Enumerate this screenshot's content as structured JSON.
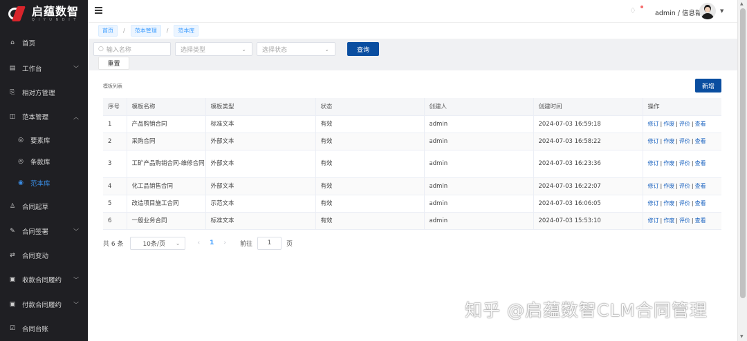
{
  "brand": {
    "title": "启蕴数智",
    "subtitle": "Q I Y U N   D I T"
  },
  "sidebar": {
    "items": [
      {
        "label": "首页",
        "icon": "home-icon",
        "glyph": "⌂",
        "expandable": false
      },
      {
        "label": "工作台",
        "icon": "workbench-icon",
        "glyph": "▤",
        "expandable": true
      },
      {
        "label": "相对方管理",
        "icon": "counterparty-icon",
        "glyph": "⎘",
        "expandable": false
      },
      {
        "label": "范本管理",
        "icon": "template-icon",
        "glyph": "◫",
        "expandable": true,
        "expanded": true
      },
      {
        "label": "要素库",
        "icon": "element-icon",
        "glyph": "◎",
        "sub": true
      },
      {
        "label": "条款库",
        "icon": "clause-icon",
        "glyph": "◎",
        "sub": true
      },
      {
        "label": "范本库",
        "icon": "template-lib-icon",
        "glyph": "◉",
        "sub": true,
        "active": true
      },
      {
        "label": "合同起草",
        "icon": "draft-icon",
        "glyph": "♙",
        "expandable": false
      },
      {
        "label": "合同签署",
        "icon": "sign-icon",
        "glyph": "✎",
        "expandable": true
      },
      {
        "label": "合同变动",
        "icon": "change-icon",
        "glyph": "⇄",
        "expandable": false
      },
      {
        "label": "收款合同履约",
        "icon": "receipt-icon",
        "glyph": "▣",
        "expandable": true
      },
      {
        "label": "付款合同履约",
        "icon": "payment-icon",
        "glyph": "▣",
        "expandable": true
      },
      {
        "label": "合同台账",
        "icon": "ledger-icon",
        "glyph": "☑",
        "expandable": false
      }
    ]
  },
  "header": {
    "user": "admin / 信息部"
  },
  "breadcrumb": [
    "首页",
    "范本管理",
    "范本库"
  ],
  "filters": {
    "name_placeholder": "输入名称",
    "type_placeholder": "选择类型",
    "status_placeholder": "选择状态",
    "query_label": "查询",
    "reset_label": "重置"
  },
  "list": {
    "title": "模板列表",
    "add_label": "新增",
    "columns": [
      "序号",
      "模板名称",
      "模板类型",
      "状态",
      "创建人",
      "创建时间",
      "操作"
    ],
    "rows": [
      {
        "no": "1",
        "name": "产品购销合同",
        "type": "标准文本",
        "status": "有效",
        "creator": "admin",
        "time": "2024-07-03 16:59:18"
      },
      {
        "no": "2",
        "name": "采购合同",
        "type": "外部文本",
        "status": "有效",
        "creator": "admin",
        "time": "2024-07-03 16:58:22"
      },
      {
        "no": "3",
        "name": "工矿产品购销合同-维修合同",
        "type": "外部文本",
        "status": "有效",
        "creator": "admin",
        "time": "2024-07-03 16:23:36"
      },
      {
        "no": "4",
        "name": "化工品销售合同",
        "type": "外部文本",
        "status": "有效",
        "creator": "admin",
        "time": "2024-07-03 16:22:07"
      },
      {
        "no": "5",
        "name": "改造项目施工合同",
        "type": "示范文本",
        "status": "有效",
        "creator": "admin",
        "time": "2024-07-03 16:06:05"
      },
      {
        "no": "6",
        "name": "一般业务合同",
        "type": "标准文本",
        "status": "有效",
        "creator": "admin",
        "time": "2024-07-03 15:53:10"
      }
    ],
    "actions": [
      "修订",
      "作废",
      "评价",
      "查看"
    ]
  },
  "pagination": {
    "total": "共 6 条",
    "page_size": "10条/页",
    "current": "1",
    "goto_label": "前往",
    "goto_value": "1",
    "page_unit": "页"
  },
  "watermark": "知乎 @启蕴数智CLM合同管理"
}
